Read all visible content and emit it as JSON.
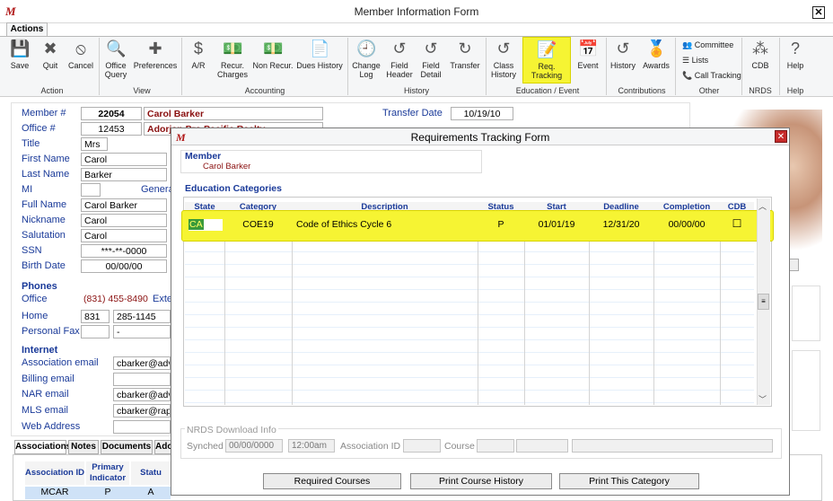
{
  "window": {
    "title": "Member Information Form",
    "close": "✕",
    "logo": "M"
  },
  "ribbon": {
    "tab": "Actions",
    "buttons": [
      {
        "label": "Save",
        "icon": "💾"
      },
      {
        "label": "Quit",
        "icon": "✖"
      },
      {
        "label": "Cancel",
        "icon": "⦸"
      },
      {
        "label": "Office Query",
        "icon": "🔍"
      },
      {
        "label": "Preferences",
        "icon": "✚"
      },
      {
        "label": "A/R",
        "icon": "$"
      },
      {
        "label": "Recur. Charges",
        "icon": "💵"
      },
      {
        "label": "Non Recur.",
        "icon": "💵"
      },
      {
        "label": "Dues History",
        "icon": "📄"
      },
      {
        "label": "Change Log",
        "icon": "🕘"
      },
      {
        "label": "Field Header",
        "icon": "↺"
      },
      {
        "label": "Field Detail",
        "icon": "↺"
      },
      {
        "label": "Transfer",
        "icon": "↻"
      },
      {
        "label": "Class History",
        "icon": "↺"
      },
      {
        "label": "Req. Tracking",
        "icon": "📝"
      },
      {
        "label": "Event",
        "icon": "📅"
      },
      {
        "label": "History",
        "icon": "↺"
      },
      {
        "label": "Awards",
        "icon": "🏅"
      },
      {
        "label": "CDB",
        "icon": "⁂"
      },
      {
        "label": "Help",
        "icon": "?"
      }
    ],
    "other": [
      "Committee",
      "Lists",
      "Call Tracking"
    ],
    "groups": [
      "Action",
      "View",
      "Accounting",
      "History",
      "Education / Event",
      "Contributions",
      "Other",
      "NRDS",
      "Help"
    ]
  },
  "member": {
    "member_no_label": "Member #",
    "member_no": "22054",
    "member_name": "Carol Barker",
    "office_label": "Office #",
    "office_no": "12453",
    "office_name": "Adorjan Pro Pacific Realty",
    "title_label": "Title",
    "title": "Mrs",
    "first_label": "First  Name",
    "first": "Carol",
    "last_label": "Last Name",
    "last": "Barker",
    "mi_label": "MI",
    "mi": "",
    "general": "General",
    "full_label": "Full Name",
    "full": "Carol Barker",
    "nick_label": "Nickname",
    "nick": "Carol",
    "sal_label": "Salutation",
    "sal": "Carol",
    "ssn_label": "SSN",
    "ssn": "***-**-0000",
    "birth_label": "Birth Date",
    "birth": "00/00/00",
    "transfer_label": "Transfer Date",
    "transfer": "10/19/10"
  },
  "phones": {
    "title": "Phones",
    "office_label": "Office",
    "office": "(831) 455-8490",
    "ext": "Exte",
    "home_label": "Home",
    "home_area": "831",
    "home": "285-1145",
    "fax_label": "Personal Fax",
    "fax": "-"
  },
  "internet": {
    "title": "Internet",
    "assoc_label": "Association email",
    "assoc": "cbarker@adv",
    "billing_label": "Billing email",
    "billing": "",
    "nar_label": "NAR email",
    "nar": "cbarker@adv",
    "mls_label": "MLS email",
    "mls": "cbarker@rap",
    "web_label": "Web Address",
    "web": ""
  },
  "bottom_tabs": [
    "Associations",
    "Notes",
    "Documents",
    "Ado"
  ],
  "assoc_table": {
    "headers": [
      "Association ID",
      "Primary Indicator",
      "Statu"
    ],
    "row": [
      "MCAR",
      "P",
      "A"
    ]
  },
  "modal": {
    "title": "Requirements Tracking Form",
    "close": "✕",
    "member_label": "Member",
    "member_name": "Carol Barker",
    "edu_label": "Education Categories",
    "headers": [
      "State",
      "Category",
      "Description",
      "Status",
      "Start",
      "Deadline",
      "Completion",
      "CDB"
    ],
    "rows": [
      [
        "CA",
        "COE19",
        "Code of Ethics Cycle 6",
        "P",
        "01/01/19",
        "12/31/20",
        "00/00/00",
        "☐"
      ]
    ],
    "nrds_label": "NRDS Download Info",
    "synched_label": "Synched",
    "synched": "00/00/0000",
    "synched_time": "12:00am",
    "assoc_id_label": "Association ID",
    "course_label": "Course",
    "buttons": [
      "Required Courses",
      "Print Course History",
      "Print This Category"
    ]
  },
  "colors": {
    "highlight": "#f6f433",
    "label_blue": "#1a3a99",
    "name_red": "#8a1010"
  }
}
